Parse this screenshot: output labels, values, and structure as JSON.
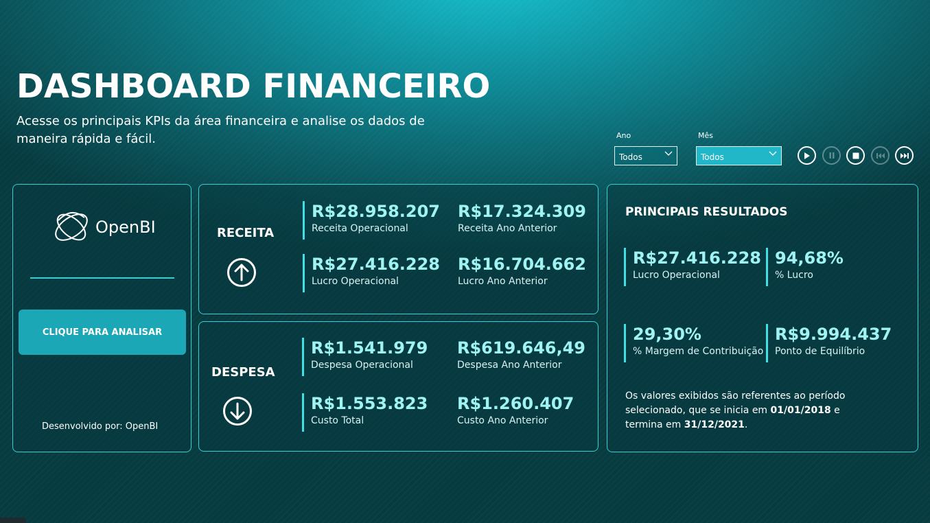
{
  "header": {
    "title": "DASHBOARD FINANCEIRO",
    "subtitle": "Acesse os principais KPIs da área financeira e analise os dados de maneira rápida e fácil."
  },
  "filters": {
    "ano": {
      "label": "Ano",
      "value": "Todos"
    },
    "mes": {
      "label": "Mês",
      "value": "Todos"
    }
  },
  "playback": {
    "icons": [
      "play-icon",
      "pause-icon",
      "stop-icon",
      "previous-icon",
      "next-icon"
    ]
  },
  "left_panel": {
    "logo_text": "OpenBI",
    "button_label": "CLIQUE PARA ANALISAR",
    "developer": "Desenvolvido por: OpenBI"
  },
  "receita": {
    "label": "RECEITA",
    "icon": "arrow-up-icon",
    "kpis": [
      {
        "value": "R$28.958.207",
        "label": "Receita Operacional"
      },
      {
        "value": "R$17.324.309",
        "label": "Receita Ano Anterior"
      },
      {
        "value": "R$27.416.228",
        "label": "Lucro Operacional"
      },
      {
        "value": "R$16.704.662",
        "label": "Lucro Ano Anterior"
      }
    ]
  },
  "despesa": {
    "label": "DESPESA",
    "icon": "arrow-down-icon",
    "kpis": [
      {
        "value": "R$1.541.979",
        "label": "Despesa Operacional"
      },
      {
        "value": "R$619.646,49",
        "label": "Despesa Ano Anterior"
      },
      {
        "value": "R$1.553.823",
        "label": "Custo Total"
      },
      {
        "value": "R$1.260.407",
        "label": "Custo Ano Anterior"
      }
    ]
  },
  "resultados": {
    "title": "PRINCIPAIS RESULTADOS",
    "kpis": [
      {
        "value": "R$27.416.228",
        "label": "Lucro Operacional"
      },
      {
        "value": "94,68%",
        "label": "% Lucro"
      },
      {
        "value": "29,30%",
        "label": "% Margem de Contribuição"
      },
      {
        "value": "R$9.994.437",
        "label": "Ponto de Equilíbrio"
      }
    ],
    "note_part1": "Os valores exibidos são referentes ao período selecionado, que se inicia em ",
    "note_start": "01/01/2018",
    "note_part2": " e termina em ",
    "note_end": "31/12/2021",
    "note_part3": "."
  },
  "colors": {
    "accent": "#35d0d6",
    "value_text": "#9ff3f3",
    "button": "#1ba7b6"
  }
}
